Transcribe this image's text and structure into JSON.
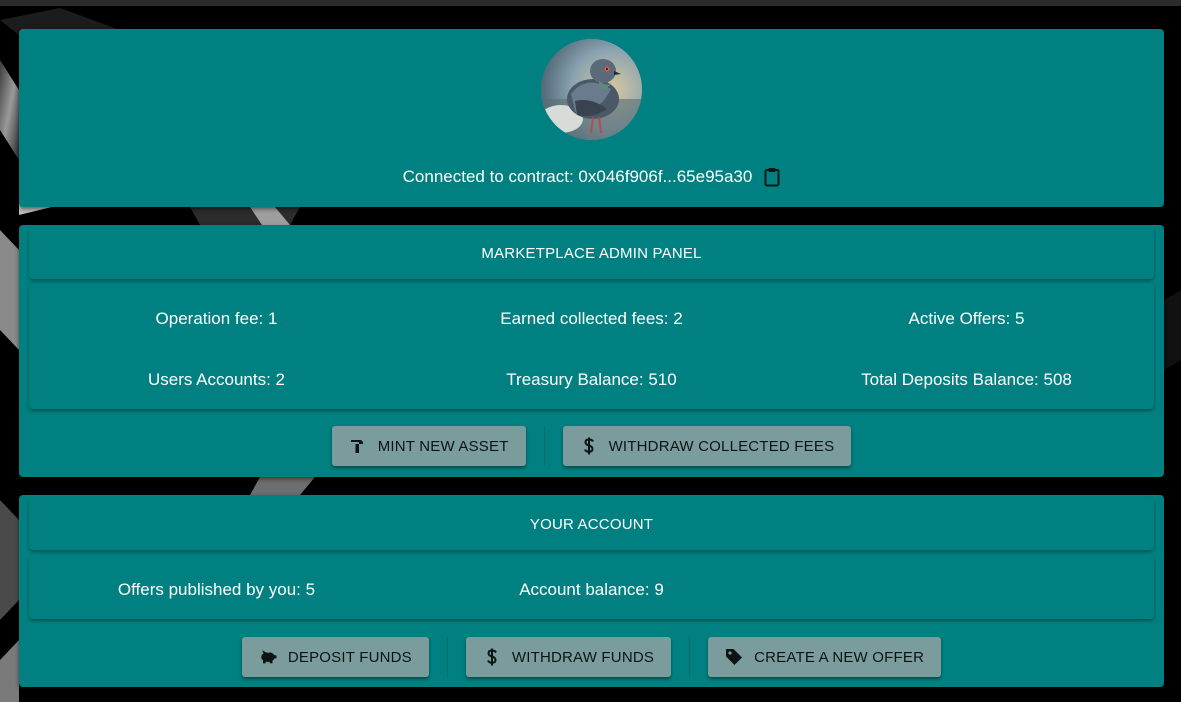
{
  "contract": {
    "label": "Connected to contract: 0x046f906f...65e95a30",
    "copy_icon": "clipboard-icon"
  },
  "admin_panel": {
    "title": "MARKETPLACE ADMIN PANEL",
    "stats": [
      "Operation fee: 1",
      "Earned collected fees: 2",
      "Active Offers: 5",
      "Users Accounts: 2",
      "Treasury Balance: 510",
      "Total Deposits Balance: 508"
    ],
    "buttons": {
      "mint": {
        "label": "MINT NEW ASSET",
        "icon": "hammer-icon"
      },
      "withdraw_fees": {
        "label": "WITHDRAW COLLECTED FEES",
        "icon": "dollar-icon"
      }
    }
  },
  "account": {
    "title": "YOUR ACCOUNT",
    "stats": [
      "Offers published by you: 5",
      "Account balance: 9"
    ],
    "buttons": {
      "deposit": {
        "label": "DEPOSIT FUNDS",
        "icon": "piggy-bank-icon"
      },
      "withdraw": {
        "label": "WITHDRAW FUNDS",
        "icon": "dollar-icon"
      },
      "create_offer": {
        "label": "CREATE A NEW OFFER",
        "icon": "tag-icon"
      }
    }
  },
  "colors": {
    "card": "#008080",
    "button": "#7a9c9c",
    "background": "#000000"
  }
}
